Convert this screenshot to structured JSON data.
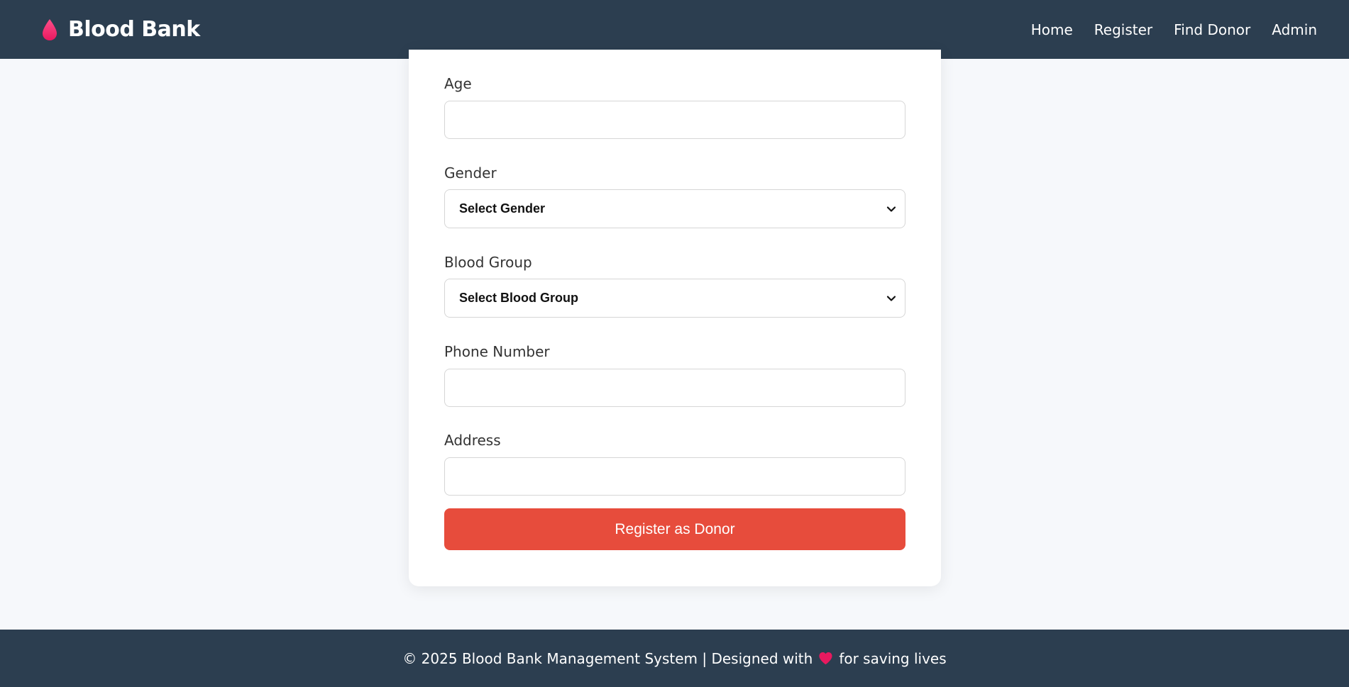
{
  "brand": {
    "title": "Blood Bank",
    "icon": "blood-drop-icon",
    "icon_color": "#e8195f"
  },
  "nav": {
    "items": [
      {
        "label": "Home"
      },
      {
        "label": "Register"
      },
      {
        "label": "Find Donor"
      },
      {
        "label": "Admin"
      }
    ]
  },
  "form": {
    "age": {
      "label": "Age",
      "value": ""
    },
    "gender": {
      "label": "Gender",
      "selected": "Select Gender"
    },
    "blood_group": {
      "label": "Blood Group",
      "selected": "Select Blood Group"
    },
    "phone": {
      "label": "Phone Number",
      "value": ""
    },
    "address": {
      "label": "Address",
      "value": ""
    },
    "submit_label": "Register as Donor"
  },
  "footer": {
    "text_before": "© 2025 Blood Bank Management System | Designed with",
    "heart_icon": "heart-icon",
    "text_after": "for saving lives"
  },
  "colors": {
    "navbar_bg": "#2c3e50",
    "page_bg": "#f6f8fb",
    "accent": "#e74c3c",
    "heart": "#e8195f"
  }
}
